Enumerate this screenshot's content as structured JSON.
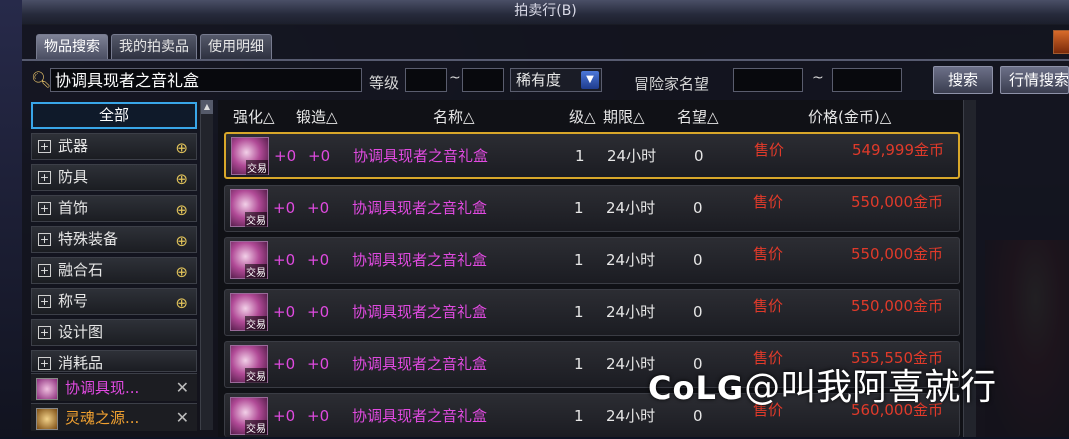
{
  "window": {
    "title": "拍卖行(B)"
  },
  "tabs": [
    {
      "label": "物品搜索",
      "active": true
    },
    {
      "label": "我的拍卖品",
      "active": false
    },
    {
      "label": "使用明细",
      "active": false
    }
  ],
  "search": {
    "query": "协调具现者之音礼盒",
    "level_label": "等级",
    "level_separator": "~",
    "rarity_label": "稀有度",
    "reputation_label": "冒险家名望",
    "reputation_separator": "~",
    "search_button": "搜索",
    "market_button": "行情搜索"
  },
  "categories": [
    {
      "label": "全部",
      "selected": true
    },
    {
      "label": "武器"
    },
    {
      "label": "防具"
    },
    {
      "label": "首饰"
    },
    {
      "label": "特殊装备"
    },
    {
      "label": "融合石"
    },
    {
      "label": "称号"
    },
    {
      "label": "设计图"
    },
    {
      "label": "消耗品"
    }
  ],
  "recent": [
    {
      "label": "协调具现..."
    },
    {
      "label": "灵魂之源..."
    }
  ],
  "columns": {
    "enhance": "强化△",
    "forge": "锻造△",
    "name": "名称△",
    "level": "级△",
    "period": "期限△",
    "reputation": "名望△",
    "price": "价格(金币)△"
  },
  "item_badge": "交易",
  "rows": [
    {
      "enhance": "+0",
      "forge": "+0",
      "name": "协调具现者之音礼盒",
      "level": "1",
      "period": "24小时",
      "reputation": "0",
      "sale": "售价",
      "price": "549,999金币"
    },
    {
      "enhance": "+0",
      "forge": "+0",
      "name": "协调具现者之音礼盒",
      "level": "1",
      "period": "24小时",
      "reputation": "0",
      "sale": "售价",
      "price": "550,000金币"
    },
    {
      "enhance": "+0",
      "forge": "+0",
      "name": "协调具现者之音礼盒",
      "level": "1",
      "period": "24小时",
      "reputation": "0",
      "sale": "售价",
      "price": "550,000金币"
    },
    {
      "enhance": "+0",
      "forge": "+0",
      "name": "协调具现者之音礼盒",
      "level": "1",
      "period": "24小时",
      "reputation": "0",
      "sale": "售价",
      "price": "550,000金币"
    },
    {
      "enhance": "+0",
      "forge": "+0",
      "name": "协调具现者之音礼盒",
      "level": "1",
      "period": "24小时",
      "reputation": "0",
      "sale": "售价",
      "price": "555,550金币"
    },
    {
      "enhance": "+0",
      "forge": "+0",
      "name": "协调具现者之音礼盒",
      "level": "1",
      "period": "24小时",
      "reputation": "0",
      "sale": "售价",
      "price": "560,000金币"
    }
  ],
  "watermark": {
    "logo": "CoLG",
    "text": "@叫我阿喜就行"
  },
  "colors": {
    "accent": "#39a6e8",
    "item_name": "#e04ae0",
    "price": "#e03a2a",
    "selected_row": "#d8a72a"
  }
}
